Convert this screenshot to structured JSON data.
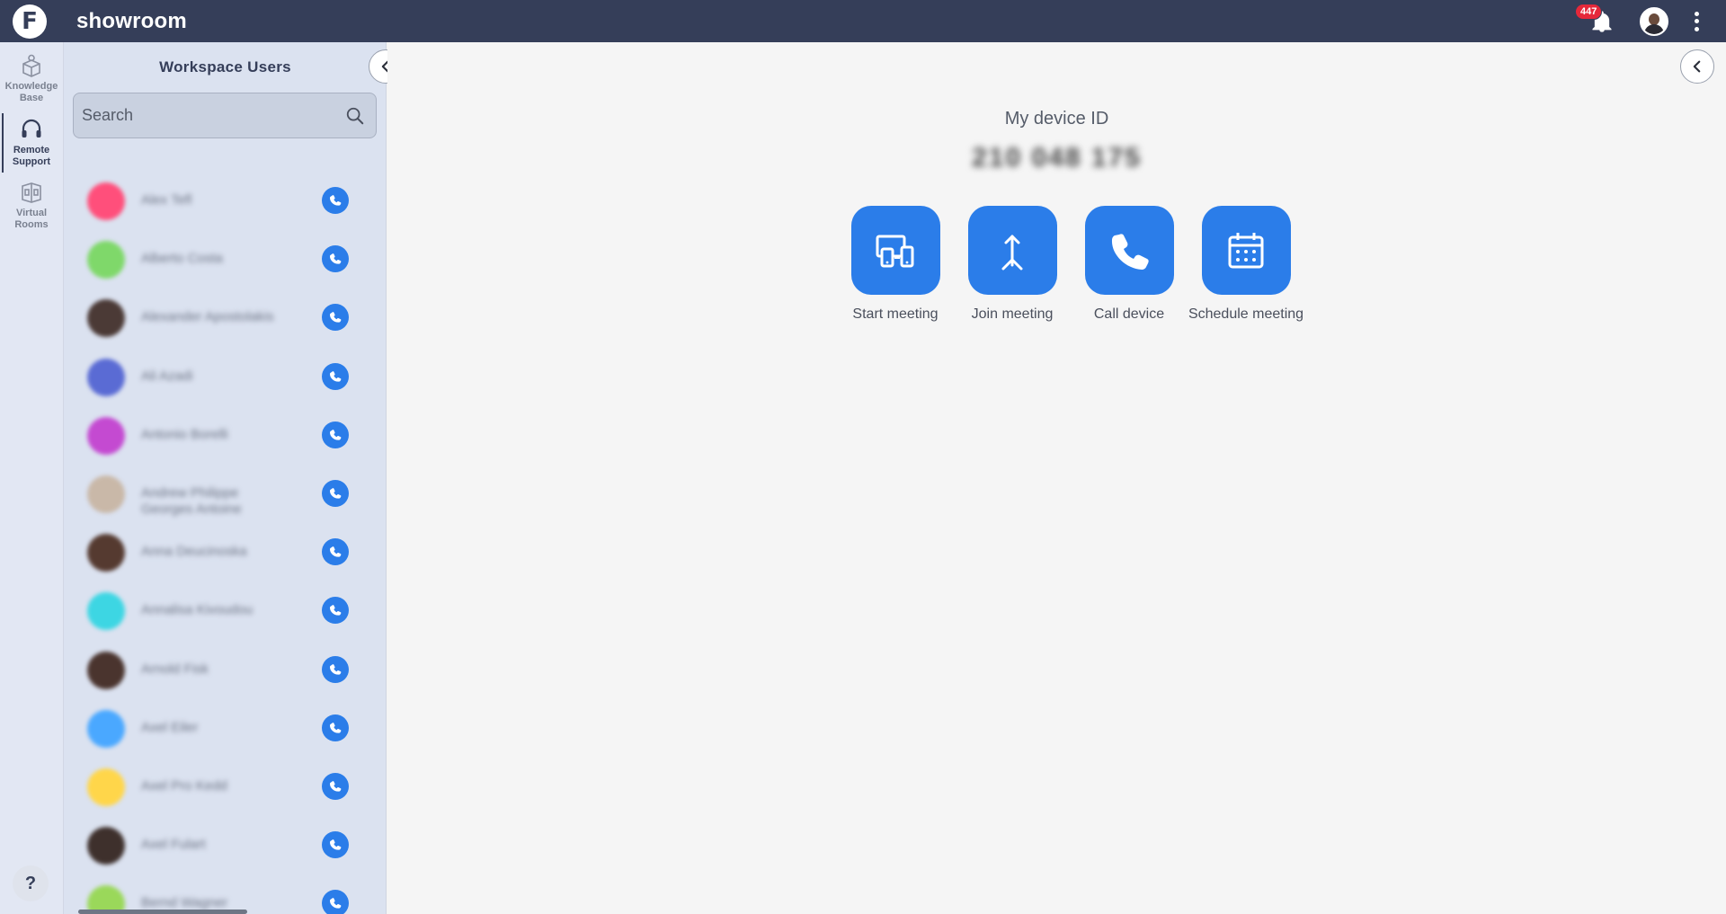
{
  "app": {
    "logo_letter": "F",
    "title": "showroom"
  },
  "header": {
    "notifications_count": "447"
  },
  "rail": {
    "items": [
      {
        "label": "Knowledge Base",
        "icon": "book-box-icon",
        "active": false
      },
      {
        "label": "Remote Support",
        "icon": "headset-icon",
        "active": true
      },
      {
        "label": "Virtual Rooms",
        "icon": "room-icon",
        "active": false
      }
    ],
    "help_label": "?"
  },
  "panel": {
    "title": "Workspace Users",
    "search_placeholder": "Search",
    "users": [
      {
        "name": "Alex Tefl",
        "color": "#ff4f7b"
      },
      {
        "name": "Alberto Costa",
        "color": "#7fd86a"
      },
      {
        "name": "Alexander Apostolakis",
        "color": "#4b3a36"
      },
      {
        "name": "Ali Azadi",
        "color": "#5a6bd4"
      },
      {
        "name": "Antonio Borelli",
        "color": "#c44ad1"
      },
      {
        "name": "Andrew Philippe Georges Antoine",
        "color": "#c9b8a8"
      },
      {
        "name": "Anna Deucinoska",
        "color": "#553a30"
      },
      {
        "name": "Annalisa Kivoudou",
        "color": "#3dd6e3"
      },
      {
        "name": "Arnold Fisk",
        "color": "#4a342e"
      },
      {
        "name": "Axel Eiler",
        "color": "#4aa8ff"
      },
      {
        "name": "Axel Pro Kedd",
        "color": "#ffd64a"
      },
      {
        "name": "Axel Fulart",
        "color": "#3e302c"
      },
      {
        "name": "Bernd Wagner",
        "color": "#9ad85a"
      }
    ]
  },
  "main": {
    "device_label": "My device ID",
    "device_id": "210 048 175",
    "actions": [
      {
        "label": "Start meeting",
        "icon": "devices-icon"
      },
      {
        "label": "Join meeting",
        "icon": "merge-arrow-icon"
      },
      {
        "label": "Call device",
        "icon": "phone-icon"
      },
      {
        "label": "Schedule meeting",
        "icon": "calendar-icon"
      }
    ]
  },
  "colors": {
    "topbar": "#353e59",
    "accent": "#2b7de9",
    "panel": "#dbe2f0",
    "badge": "#e5283a"
  }
}
